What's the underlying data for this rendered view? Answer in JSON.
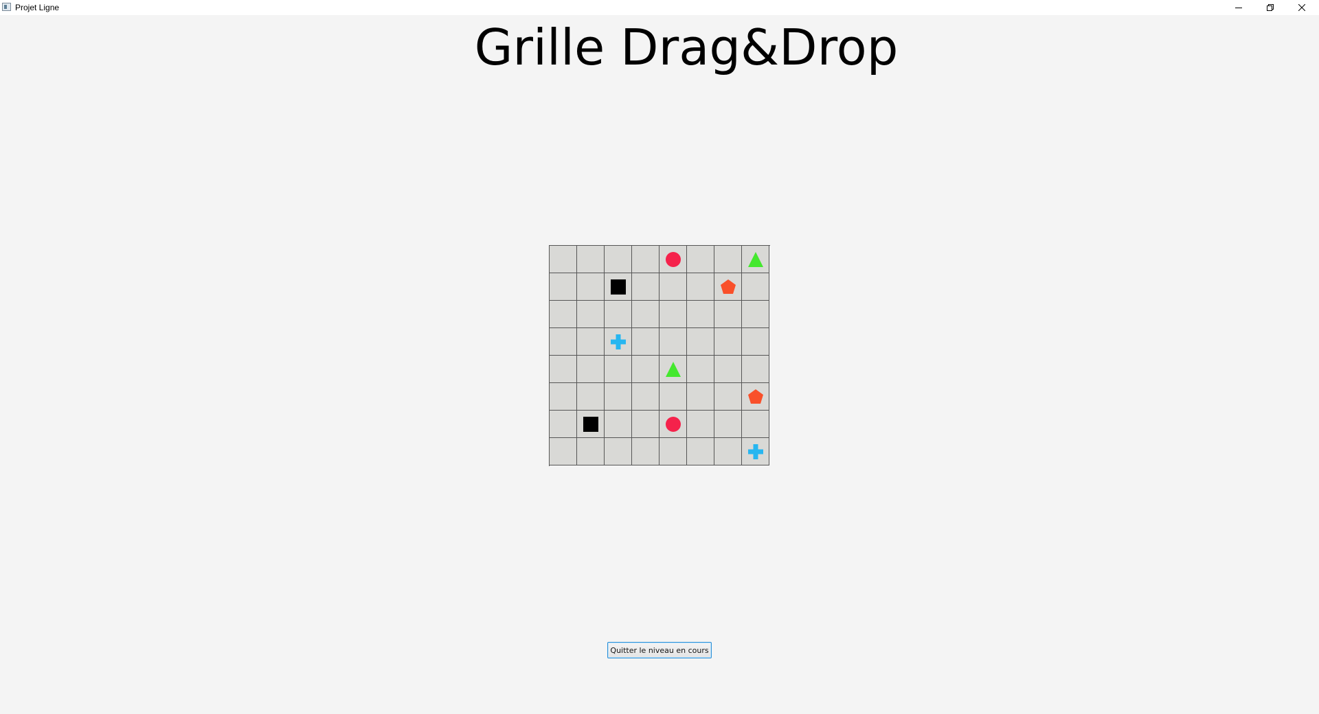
{
  "window": {
    "title": "Projet Ligne",
    "controls": [
      "minimize-icon",
      "restore-icon",
      "close-icon"
    ]
  },
  "page": {
    "title": "Grille Drag&Drop"
  },
  "grid": {
    "rows": 8,
    "cols": 8,
    "cell_color": "#d9d9d6",
    "line_color": "#555555",
    "pieces": [
      {
        "row": 0,
        "col": 4,
        "shape": "circle",
        "color": "#f5224b"
      },
      {
        "row": 0,
        "col": 7,
        "shape": "triangle",
        "color": "#44e82e"
      },
      {
        "row": 1,
        "col": 2,
        "shape": "square",
        "color": "#000000"
      },
      {
        "row": 1,
        "col": 6,
        "shape": "pentagon",
        "color": "#f9502a"
      },
      {
        "row": 3,
        "col": 2,
        "shape": "cross",
        "color": "#27b6f0"
      },
      {
        "row": 4,
        "col": 4,
        "shape": "triangle",
        "color": "#44e82e"
      },
      {
        "row": 5,
        "col": 7,
        "shape": "pentagon",
        "color": "#f9502a"
      },
      {
        "row": 6,
        "col": 1,
        "shape": "square",
        "color": "#000000"
      },
      {
        "row": 6,
        "col": 4,
        "shape": "circle",
        "color": "#f5224b"
      },
      {
        "row": 7,
        "col": 7,
        "shape": "cross",
        "color": "#27b6f0"
      }
    ]
  },
  "actions": {
    "quit_label": "Quitter le niveau en cours"
  }
}
